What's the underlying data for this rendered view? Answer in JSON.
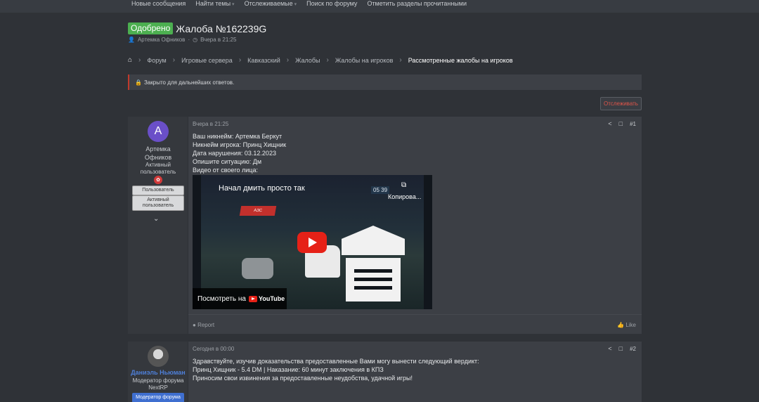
{
  "topnav": {
    "items": [
      {
        "label": "Новые сообщения",
        "caret": false
      },
      {
        "label": "Найти темы",
        "caret": true
      },
      {
        "label": "Отслеживаемые",
        "caret": true
      },
      {
        "label": "Поиск по форуму",
        "caret": false
      },
      {
        "label": "Отметить разделы прочитанными",
        "caret": false
      }
    ]
  },
  "thread": {
    "badge": "Одобрено",
    "title": "Жалоба №162239G",
    "author": "Артемка Офников",
    "date": "Вчера в 21:25"
  },
  "breadcrumbs": {
    "home_icon": "home-icon",
    "items": [
      "Форум",
      "Игровые сервера",
      "Кавказский",
      "Жалобы",
      "Жалобы на игроков"
    ],
    "current": "Рассмотренные жалобы на игроков"
  },
  "notice": {
    "icon": "lock-icon",
    "text": "Закрыто для дальнейших ответов."
  },
  "follow_button": "Отслеживать",
  "posts": [
    {
      "avatar_letter": "A",
      "username": "Артемка\nОфников",
      "username_line1": "Артемка",
      "username_line2": "Офников",
      "user_title_line1": "Активный",
      "user_title_line2": "пользователь",
      "banners": [
        "Пользователь",
        "Активный пользователь"
      ],
      "banner2_line1": "Активный",
      "banner2_line2": "пользователь",
      "date": "Вчера в 21:25",
      "number": "#1",
      "lines": [
        "Ваш никнейм: Артемка Беркут",
        "Никнейм игрока: Принц Хищник",
        "Дата нарушения: 03.12.2023",
        "Опишите ситуацию: Дм",
        "Видео от своего лица:"
      ],
      "video": {
        "title": "Начал дмить просто так",
        "copy_label": "Копирова...",
        "timer": "05 39",
        "sign": "АЗС",
        "watch_label": "Посмотреть на",
        "youtube": "YouTube"
      },
      "report": "Report",
      "like": "Like"
    },
    {
      "username": "Даниэль Ньюман",
      "user_title_line1": "Модератор форума",
      "user_title_line2": "NextRP",
      "banner": "Модератор форума",
      "date": "Сегодня в 00:00",
      "number": "#2",
      "lines": [
        "Здравствуйте, изучив доказательства предоставленные Вами могу вынести следующий вердикт:",
        "Принц Хищник - 5.4 DM | Наказание: 60 минут заключения в КПЗ",
        "Приносим свои извинения за предоставленные неудобства, удачной игры!"
      ]
    }
  ],
  "colors": {
    "approved": "#4caf50",
    "danger": "#c0392b",
    "avatar": "#6a4fc8",
    "moderator": "#4e7fd8",
    "youtube": "#e62117"
  }
}
